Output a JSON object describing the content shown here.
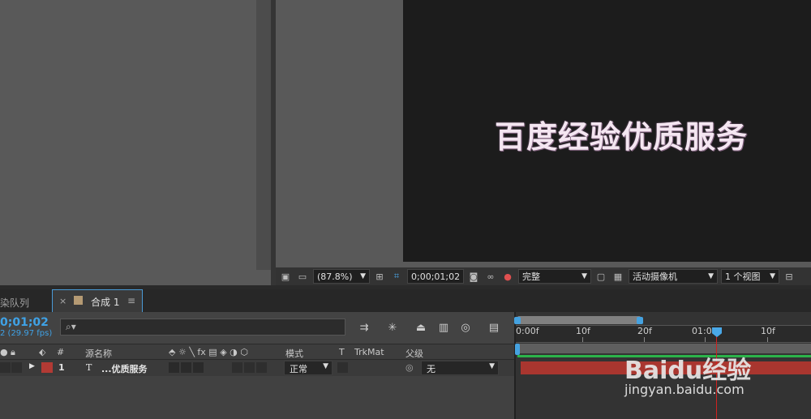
{
  "canvas_text": "百度经验优质服务",
  "viewer_toolbar": {
    "zoom": "(87.8%)",
    "timecode": "0;00;01;02",
    "resolution": "完整",
    "camera": "活动摄像机",
    "views": "1 个视图"
  },
  "timeline": {
    "tab_render_queue": "染队列",
    "tab_comp_close": "×",
    "tab_comp_label": "合成 1",
    "tab_comp_menu": "≡",
    "current_time": "0;01;02",
    "fps": "2 (29.97 fps)",
    "search_placeholder": "⌕▾",
    "columns": {
      "num": "#",
      "source_name": "源名称",
      "switches": "⬘ ☼ ╲ fx ▤ ◈ ◑ ⬡",
      "mode": "模式",
      "t": "T",
      "trkmat": "TrkMat",
      "parent": "父级"
    },
    "layers": [
      {
        "index": "1",
        "type_icon": "T",
        "name": "...优质服务",
        "mode": "正常",
        "parent": "无",
        "color": "#b23a34"
      }
    ],
    "ruler_labels": [
      "0:00f",
      "10f",
      "20f",
      "01:00f",
      "10f"
    ]
  },
  "watermark": {
    "logo": "Baidu经验",
    "url": "jingyan.baidu.com"
  },
  "colors": {
    "accent_blue": "#45a2e0",
    "playhead_red": "#d0221f",
    "layer_red": "#a9362f",
    "canvas_text": "#f4e6f1"
  }
}
